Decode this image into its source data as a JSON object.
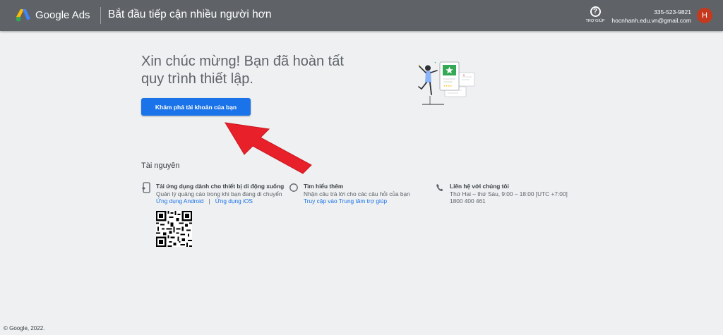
{
  "header": {
    "brand": "Google Ads",
    "page_title": "Bắt đầu tiếp cận nhiều người hơn",
    "help_label": "TRỢ GIÚP",
    "account_id": "335-523-9821",
    "account_email": "hocnhanh.edu.vn@gmail.com",
    "avatar_letter": "H"
  },
  "main": {
    "congrats": "Xin chúc mừng! Bạn đã hoàn tất quy trình thiết lập.",
    "explore_button": "Khám phá tài khoản của bạn"
  },
  "resources": {
    "title": "Tài nguyên",
    "mobile": {
      "title": "Tải ứng dụng dành cho thiết bị di động xuống",
      "desc": "Quản lý quảng cáo trong khi bạn đang di chuyển",
      "android_link": "Ứng dụng Android",
      "separator": "|",
      "ios_link": "Ứng dụng iOS"
    },
    "learn": {
      "title": "Tìm hiểu thêm",
      "desc": "Nhận câu trả lời cho các câu hỏi của bạn",
      "link": "Truy cập vào Trung tâm trợ giúp"
    },
    "contact": {
      "title": "Liên hệ với chúng tôi",
      "hours": "Thứ Hai – thứ Sáu, 9:00 – 18:00 [UTC +7:00]",
      "phone": "1800 400 461"
    }
  },
  "footer": {
    "copyright": "© Google, 2022."
  },
  "icons": {
    "logo": "google-ads-logo",
    "help": "help-circle-icon",
    "mobile": "mobile-download-icon",
    "learn": "learn-more-icon",
    "contact": "phone-icon",
    "arrow": "red-arrow-annotation"
  },
  "colors": {
    "topbar": "#5f6368",
    "primary_button": "#1a73e8",
    "link": "#1a73e8",
    "avatar": "#c5391f",
    "arrow": "#e8202a",
    "background": "#eef0f2"
  }
}
